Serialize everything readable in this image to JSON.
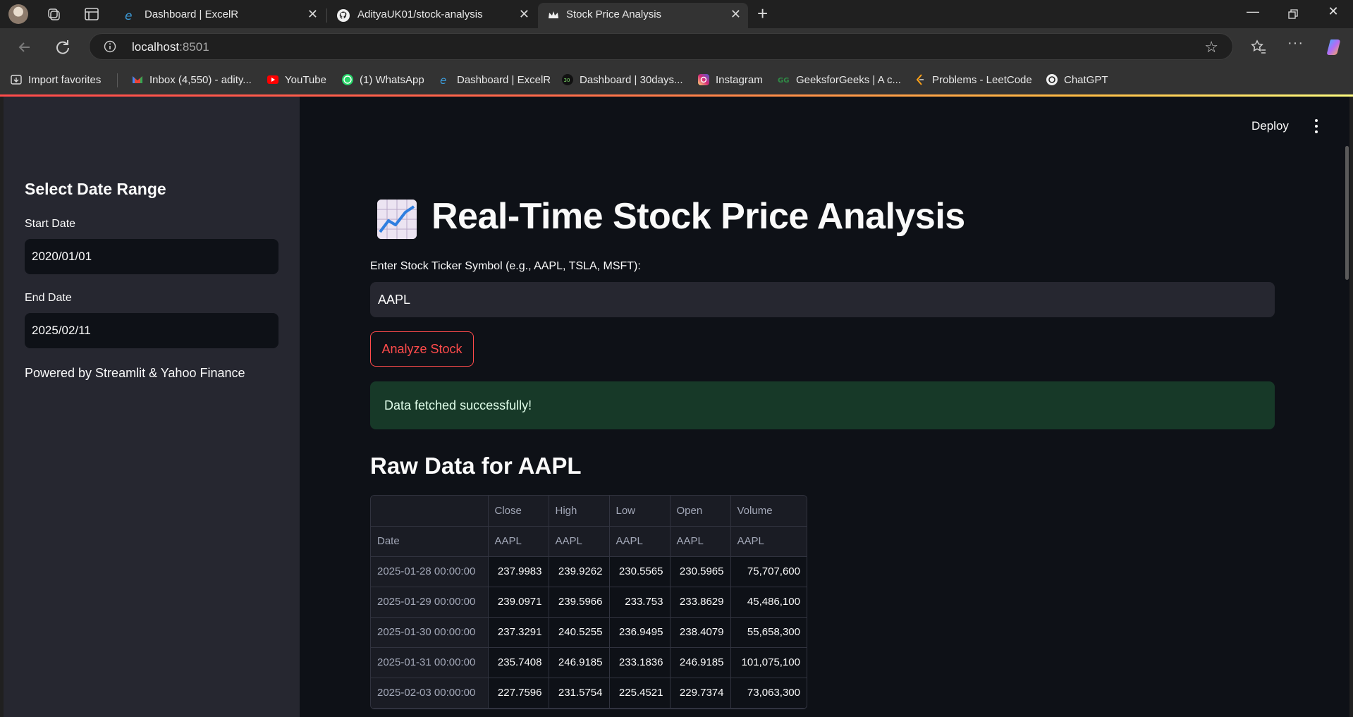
{
  "browser": {
    "tabs": [
      {
        "title": "Dashboard | ExcelR"
      },
      {
        "title": "AdityaUK01/stock-analysis"
      },
      {
        "title": "Stock Price Analysis"
      }
    ],
    "url": {
      "host": "localhost",
      "port": ":8501"
    },
    "bookmarks": [
      {
        "label": "Import favorites"
      },
      {
        "label": "Inbox (4,550) - adity..."
      },
      {
        "label": "YouTube"
      },
      {
        "label": "(1) WhatsApp"
      },
      {
        "label": "Dashboard | ExcelR"
      },
      {
        "label": "Dashboard | 30days..."
      },
      {
        "label": "Instagram"
      },
      {
        "label": "GeeksforGeeks | A c..."
      },
      {
        "label": "Problems - LeetCode"
      },
      {
        "label": "ChatGPT"
      }
    ]
  },
  "sidebar": {
    "heading": "Select Date Range",
    "start_label": "Start Date",
    "start_value": "2020/01/01",
    "end_label": "End Date",
    "end_value": "2025/02/11",
    "powered_by": "Powered by Streamlit & Yahoo Finance"
  },
  "header": {
    "deploy_label": "Deploy"
  },
  "main": {
    "title": "Real-Time Stock Price Analysis",
    "ticker_label": "Enter Stock Ticker Symbol (e.g., AAPL, TSLA, MSFT):",
    "ticker_value": "AAPL",
    "analyze_label": "Analyze Stock",
    "success_message": "Data fetched successfully!",
    "raw_heading": "Raw Data for AAPL"
  },
  "table": {
    "columns": [
      "Close",
      "High",
      "Low",
      "Open",
      "Volume"
    ],
    "subheader_index": "Date",
    "tickers": [
      "AAPL",
      "AAPL",
      "AAPL",
      "AAPL",
      "AAPL"
    ],
    "rows": [
      {
        "date": "2025-01-28 00:00:00",
        "values": [
          "237.9983",
          "239.9262",
          "230.5565",
          "230.5965",
          "75,707,600"
        ]
      },
      {
        "date": "2025-01-29 00:00:00",
        "values": [
          "239.0971",
          "239.5966",
          "233.753",
          "233.8629",
          "45,486,100"
        ]
      },
      {
        "date": "2025-01-30 00:00:00",
        "values": [
          "237.3291",
          "240.5255",
          "236.9495",
          "238.4079",
          "55,658,300"
        ]
      },
      {
        "date": "2025-01-31 00:00:00",
        "values": [
          "235.7408",
          "246.9185",
          "233.1836",
          "246.9185",
          "101,075,100"
        ]
      },
      {
        "date": "2025-02-03 00:00:00",
        "values": [
          "227.7596",
          "231.5754",
          "225.4521",
          "229.7374",
          "73,063,300"
        ]
      }
    ]
  },
  "colors": {
    "accent": "#ff4b4b",
    "success_bg": "#173928",
    "sidebar_bg": "#262730",
    "app_bg": "#0e1117"
  },
  "icons": {
    "chart": "chart-increasing-icon"
  }
}
